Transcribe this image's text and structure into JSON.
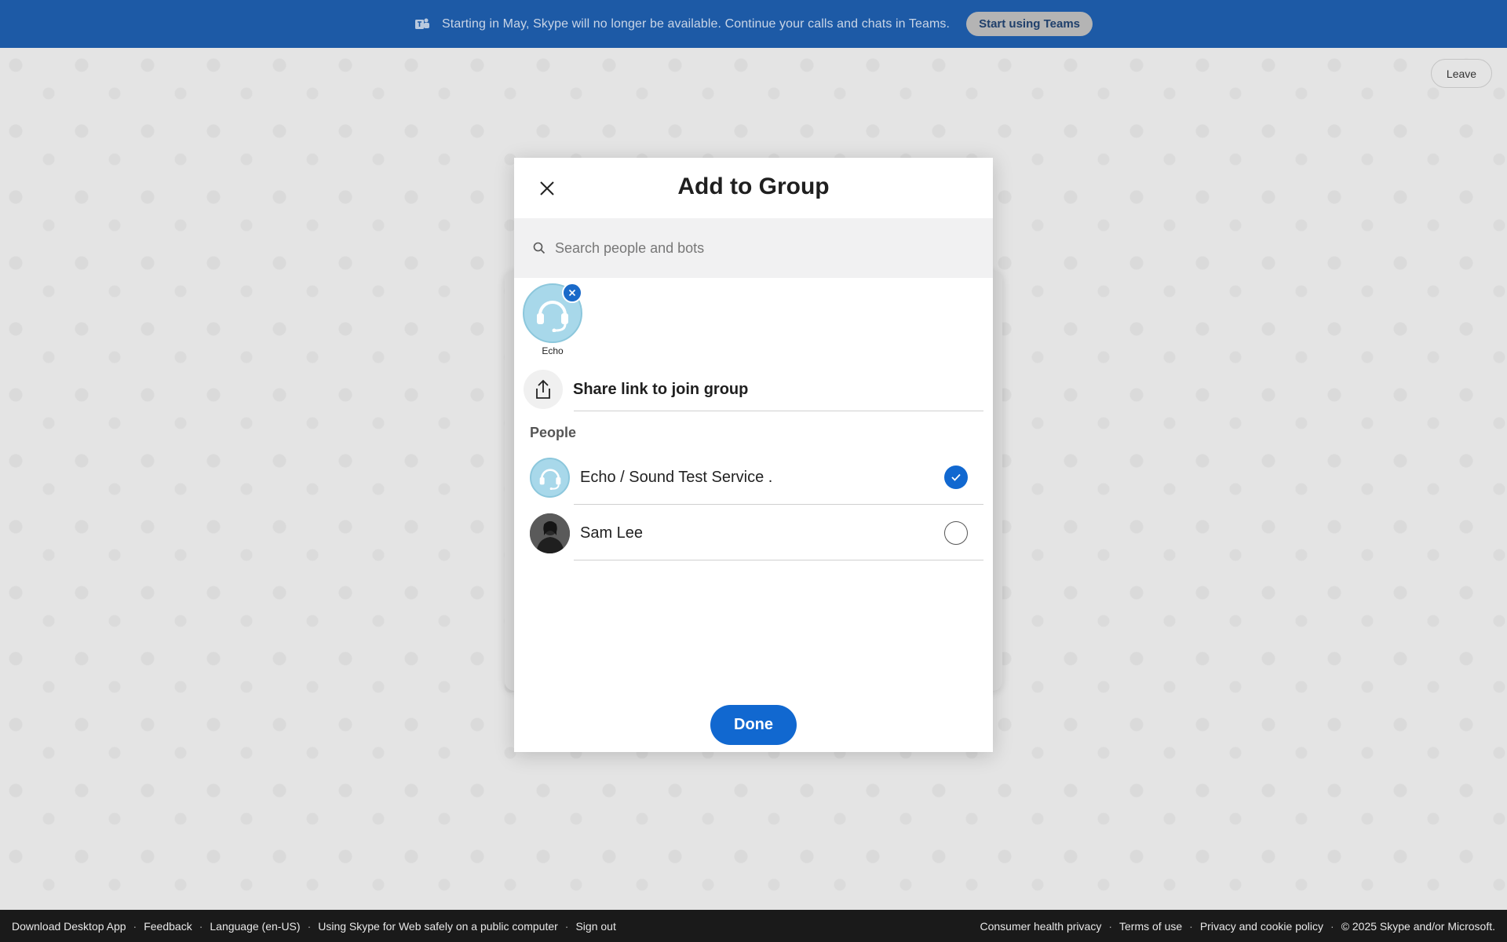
{
  "banner": {
    "message": "Starting in May, Skype will no longer be available. Continue your calls and chats in Teams.",
    "button_label": "Start using Teams",
    "icon": "teams-icon"
  },
  "header": {
    "leave_label": "Leave"
  },
  "modal": {
    "title": "Add to Group",
    "search_placeholder": "Search people and bots",
    "selected": [
      {
        "name": "Echo"
      }
    ],
    "share_label": "Share link to join group",
    "section_label": "People",
    "people": [
      {
        "name": "Echo / Sound Test Service .",
        "checked": true
      },
      {
        "name": "Sam Lee",
        "checked": false
      }
    ],
    "done_label": "Done"
  },
  "footer": {
    "left_links": [
      "Download Desktop App",
      "Feedback",
      "Language (en-US)",
      "Using Skype for Web safely on a public computer",
      "Sign out"
    ],
    "right_links": [
      "Consumer health privacy",
      "Terms of use",
      "Privacy and cookie policy"
    ],
    "copyright": "© 2025 Skype and/or Microsoft."
  },
  "colors": {
    "banner": "#1d5aa6",
    "accent": "#1168d0",
    "echo_avatar": "#a8d8ea"
  }
}
